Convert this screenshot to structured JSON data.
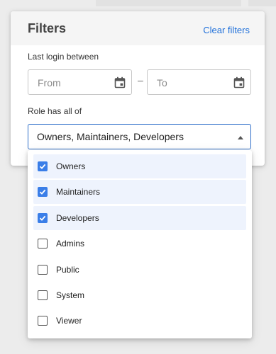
{
  "filters": {
    "title": "Filters",
    "clear_label": "Clear filters",
    "last_login_label": "Last login between",
    "from_placeholder": "From",
    "range_separator": "–",
    "to_placeholder": "To",
    "role_label": "Role has all of",
    "role_value": "Owners, Maintainers, Developers"
  },
  "dropdown": {
    "options": [
      {
        "label": "Owners",
        "checked": true
      },
      {
        "label": "Maintainers",
        "checked": true
      },
      {
        "label": "Developers",
        "checked": true
      },
      {
        "label": "Admins",
        "checked": false
      },
      {
        "label": "Public",
        "checked": false
      },
      {
        "label": "System",
        "checked": false
      },
      {
        "label": "Viewer",
        "checked": false
      }
    ]
  },
  "colors": {
    "accent": "#1e6fd9",
    "checkbox_checked": "#3a7ee8",
    "selected_row": "#eef3fd"
  },
  "icons": {
    "calendar": "calendar-icon",
    "caret": "caret-up-icon",
    "check": "check-icon"
  }
}
